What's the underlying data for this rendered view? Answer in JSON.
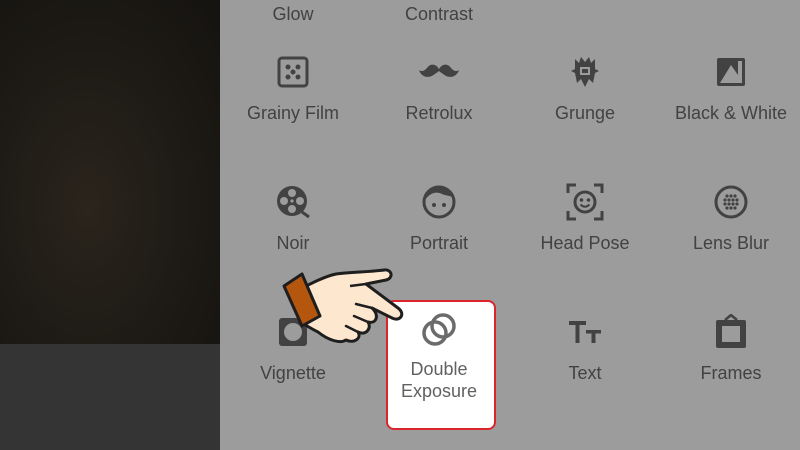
{
  "photo_preview": {
    "alt": "photo"
  },
  "panel": {
    "partial_labels": [
      "Glow",
      "Contrast"
    ],
    "tools": [
      {
        "id": "grainy-film",
        "label": "Grainy Film",
        "icon": "dice-icon"
      },
      {
        "id": "retrolux",
        "label": "Retrolux",
        "icon": "mustache-icon"
      },
      {
        "id": "grunge",
        "label": "Grunge",
        "icon": "grunge-icon"
      },
      {
        "id": "black-white",
        "label": "Black & White",
        "icon": "bw-icon"
      },
      {
        "id": "noir",
        "label": "Noir",
        "icon": "film-reel-icon"
      },
      {
        "id": "portrait",
        "label": "Portrait",
        "icon": "face-icon"
      },
      {
        "id": "head-pose",
        "label": "Head Pose",
        "icon": "head-pose-icon"
      },
      {
        "id": "lens-blur",
        "label": "Lens Blur",
        "icon": "lens-blur-icon"
      },
      {
        "id": "vignette",
        "label": "Vignette",
        "icon": "vignette-icon"
      },
      {
        "id": "double-exposure",
        "label": "Double\nExposure",
        "icon": "double-exposure-icon"
      },
      {
        "id": "text",
        "label": "Text",
        "icon": "text-icon"
      },
      {
        "id": "frames",
        "label": "Frames",
        "icon": "frames-icon"
      }
    ]
  },
  "colors": {
    "panel_bg": "#9c9c9c",
    "icon": "#424242",
    "highlight_border": "#d9252b"
  }
}
